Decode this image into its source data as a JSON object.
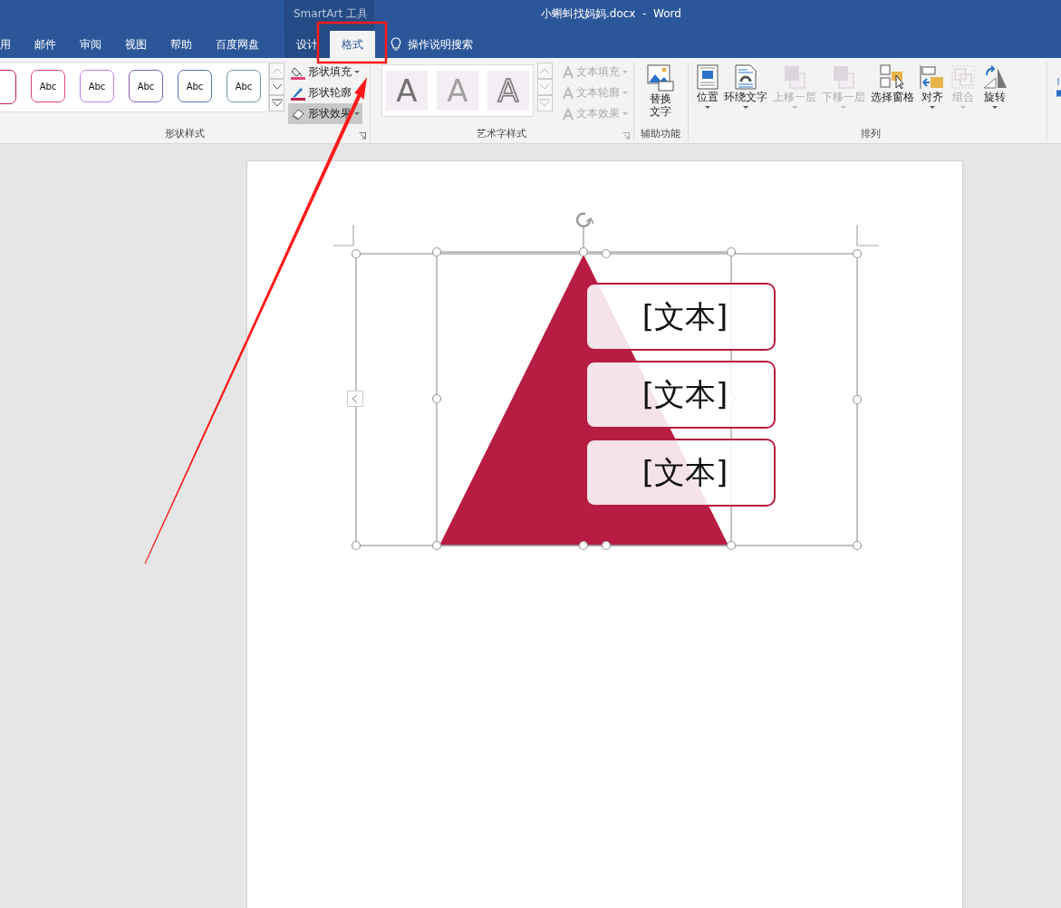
{
  "title_bar": {
    "context_tool": "SmartArt 工具",
    "document_title": "小蝌蚪找妈妈.docx  -  Word"
  },
  "tabs": [
    {
      "label": "用",
      "selected": false,
      "contextual": false
    },
    {
      "label": "邮件",
      "selected": false,
      "contextual": false
    },
    {
      "label": "审阅",
      "selected": false,
      "contextual": false
    },
    {
      "label": "视图",
      "selected": false,
      "contextual": false
    },
    {
      "label": "帮助",
      "selected": false,
      "contextual": false
    },
    {
      "label": "百度网盘",
      "selected": false,
      "contextual": false
    },
    {
      "label": "设计",
      "selected": false,
      "contextual": true
    },
    {
      "label": "格式",
      "selected": true,
      "contextual": true
    }
  ],
  "tell_me": "操作说明搜索",
  "shape_styles": {
    "label": "形状样式",
    "gallery": [
      {
        "color": "#c41e4a"
      },
      {
        "text": "Abc",
        "color": "#e0457a"
      },
      {
        "text": "Abc",
        "color": "#c27ee8"
      },
      {
        "text": "Abc",
        "color": "#7e5cb0"
      },
      {
        "text": "Abc",
        "color": "#5670ae"
      },
      {
        "text": "Abc",
        "color": "#6c98a4"
      }
    ],
    "commands": [
      {
        "label": "形状填充",
        "kind": "fill",
        "highlighted": false,
        "has_menu": true
      },
      {
        "label": "形状轮廓",
        "kind": "outline",
        "highlighted": false,
        "has_menu": false
      },
      {
        "label": "形状效果",
        "kind": "effect",
        "highlighted": true,
        "has_menu": true
      }
    ]
  },
  "wordart_styles": {
    "label": "艺术字样式",
    "tiles": [
      {
        "text": "A",
        "kind": "solid"
      },
      {
        "text": "A",
        "kind": "light"
      },
      {
        "text": "A",
        "kind": "outline"
      }
    ],
    "commands": [
      {
        "label": "文本填充",
        "disabled": true
      },
      {
        "label": "文本轮廓",
        "disabled": true
      },
      {
        "label": "文本效果",
        "disabled": true
      }
    ]
  },
  "accessibility": {
    "label": "辅助功能",
    "button": "替换文字"
  },
  "arrange": {
    "label": "排列",
    "buttons": [
      {
        "label": "位置",
        "kind": "position",
        "disabled": false,
        "has_menu": true
      },
      {
        "label": "环绕文字",
        "kind": "wrap",
        "disabled": false,
        "has_menu": true
      },
      {
        "label": "上移一层",
        "kind": "forward",
        "disabled": true,
        "has_menu": true
      },
      {
        "label": "下移一层",
        "kind": "backward",
        "disabled": true,
        "has_menu": true
      },
      {
        "label": "选择窗格",
        "kind": "pane",
        "disabled": false,
        "has_menu": false
      },
      {
        "label": "对齐",
        "kind": "align",
        "disabled": false,
        "has_menu": true
      },
      {
        "label": "组合",
        "kind": "group",
        "disabled": true,
        "has_menu": true
      },
      {
        "label": "旋转",
        "kind": "rotate",
        "disabled": false,
        "has_menu": true
      }
    ]
  },
  "smartart": {
    "items": [
      "[文本]",
      "[文本]",
      "[文本]"
    ]
  }
}
